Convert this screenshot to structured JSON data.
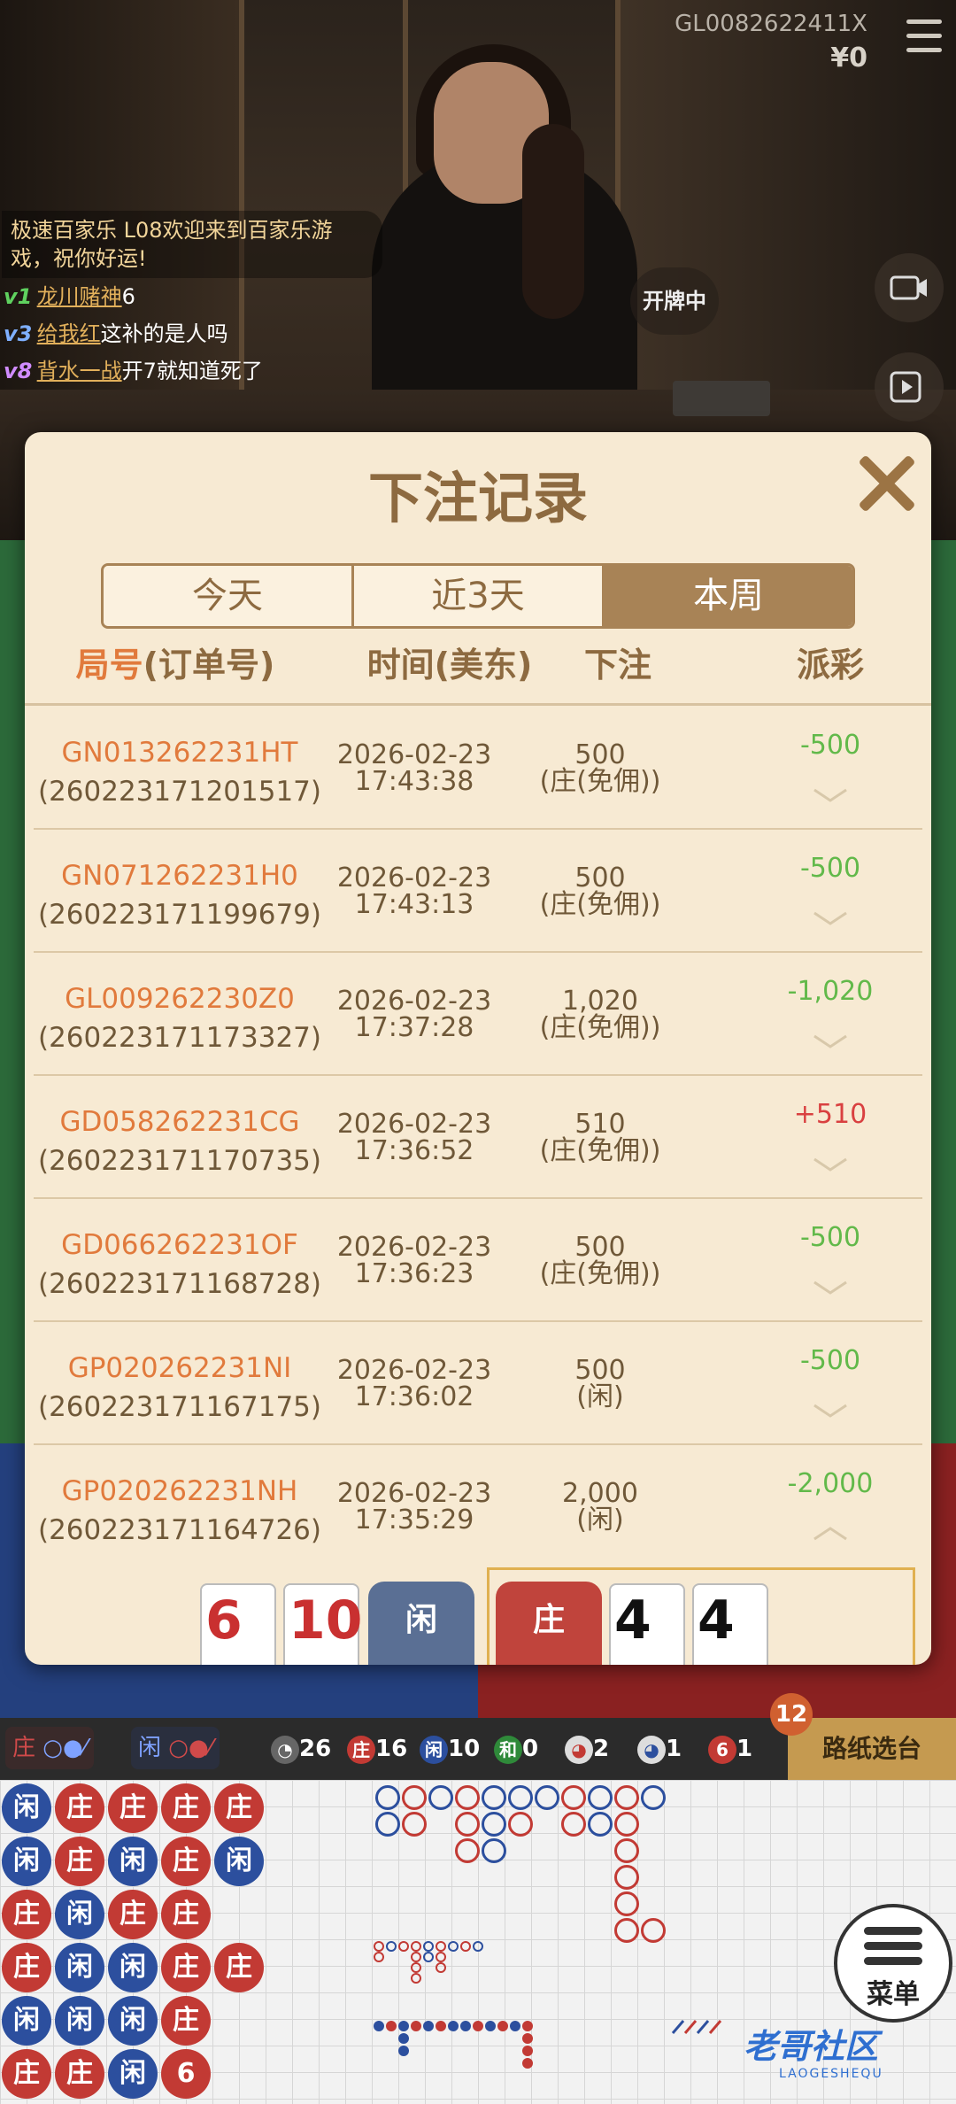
{
  "header": {
    "account_id": "GL0082622411X",
    "balance": "¥0",
    "status": "开牌中"
  },
  "chat": {
    "system_message": "极速百家乐 L08欢迎来到百家乐游戏，祝你好运!",
    "lines": [
      {
        "level": "v1",
        "level_color": "#5fd15f",
        "user": "龙川赌神",
        "message": "6"
      },
      {
        "level": "v3",
        "level_color": "#7fb0ff",
        "user": "给我红",
        "message": "这补的是人吗"
      },
      {
        "level": "v8",
        "level_color": "#d08cff",
        "user": "背水一战",
        "message": "开7就知道死了"
      }
    ]
  },
  "modal": {
    "title": "下注记录",
    "tabs": [
      {
        "label": "今天",
        "active": false
      },
      {
        "label": "近3天",
        "active": false
      },
      {
        "label": "本周",
        "active": true
      }
    ],
    "columns": {
      "round_prefix": "局号",
      "round_suffix": "(订单号)",
      "time": "时间(美东)",
      "bet": "下注",
      "payout": "派彩"
    },
    "records": [
      {
        "round": "GN013262231HT",
        "order": "(260223171201517)",
        "date": "2026-02-23",
        "time": "17:43:38",
        "amount": "500",
        "side": "(庄(免佣))",
        "payout": "-500",
        "sign": "neg",
        "expanded": false
      },
      {
        "round": "GN071262231H0",
        "order": "(260223171199679)",
        "date": "2026-02-23",
        "time": "17:43:13",
        "amount": "500",
        "side": "(庄(免佣))",
        "payout": "-500",
        "sign": "neg",
        "expanded": false
      },
      {
        "round": "GL009262230Z0",
        "order": "(260223171173327)",
        "date": "2026-02-23",
        "time": "17:37:28",
        "amount": "1,020",
        "side": "(庄(免佣))",
        "payout": "-1,020",
        "sign": "neg",
        "expanded": false
      },
      {
        "round": "GD058262231CG",
        "order": "(260223171170735)",
        "date": "2026-02-23",
        "time": "17:36:52",
        "amount": "510",
        "side": "(庄(免佣))",
        "payout": "+510",
        "sign": "pos",
        "expanded": false
      },
      {
        "round": "GD066262231OF",
        "order": "(260223171168728)",
        "date": "2026-02-23",
        "time": "17:36:23",
        "amount": "500",
        "side": "(庄(免佣))",
        "payout": "-500",
        "sign": "neg",
        "expanded": false
      },
      {
        "round": "GP020262231NI",
        "order": "(260223171167175)",
        "date": "2026-02-23",
        "time": "17:36:02",
        "amount": "500",
        "side": "(闲)",
        "payout": "-500",
        "sign": "neg",
        "expanded": false
      },
      {
        "round": "GP020262231NH",
        "order": "(260223171164726)",
        "date": "2026-02-23",
        "time": "17:35:29",
        "amount": "2,000",
        "side": "(闲)",
        "payout": "-2,000",
        "sign": "neg",
        "expanded": true
      }
    ],
    "detail": {
      "player_label": "闲",
      "banker_label": "庄",
      "player_cards": [
        "6",
        "10"
      ],
      "banker_cards": [
        "4",
        "4"
      ]
    }
  },
  "stats": {
    "ask_banker": "庄",
    "ask_player": "闲",
    "total": "26",
    "banker_label": "庄",
    "banker_count": "16",
    "player_label": "闲",
    "player_count": "10",
    "tie_label": "和",
    "tie_count": "0",
    "banker_pair_count": "2",
    "player_pair_count": "1",
    "lucky6_label": "6",
    "lucky6_count": "1",
    "road_select": "路纸选台",
    "table_count": "12"
  },
  "bead_road": [
    [
      "闲",
      "闲",
      "庄",
      "庄",
      "闲",
      "庄"
    ],
    [
      "庄",
      "庄",
      "闲",
      "闲",
      "闲",
      "庄"
    ],
    [
      "庄",
      "闲",
      "庄",
      "闲",
      "闲",
      "闲"
    ],
    [
      "庄",
      "庄",
      "庄",
      "庄",
      "庄",
      "6"
    ],
    [
      "庄",
      "闲",
      "",
      "庄",
      "",
      ""
    ]
  ],
  "menu_label": "菜单",
  "logo": {
    "text": "老哥社区",
    "sub": "LAOGESHEQU"
  },
  "colors": {
    "banker": "#c23a34",
    "player": "#2c4f9e",
    "tie": "#2f8a3a",
    "accent": "#a88356",
    "loss": "#62b94a",
    "win": "#d94040"
  }
}
